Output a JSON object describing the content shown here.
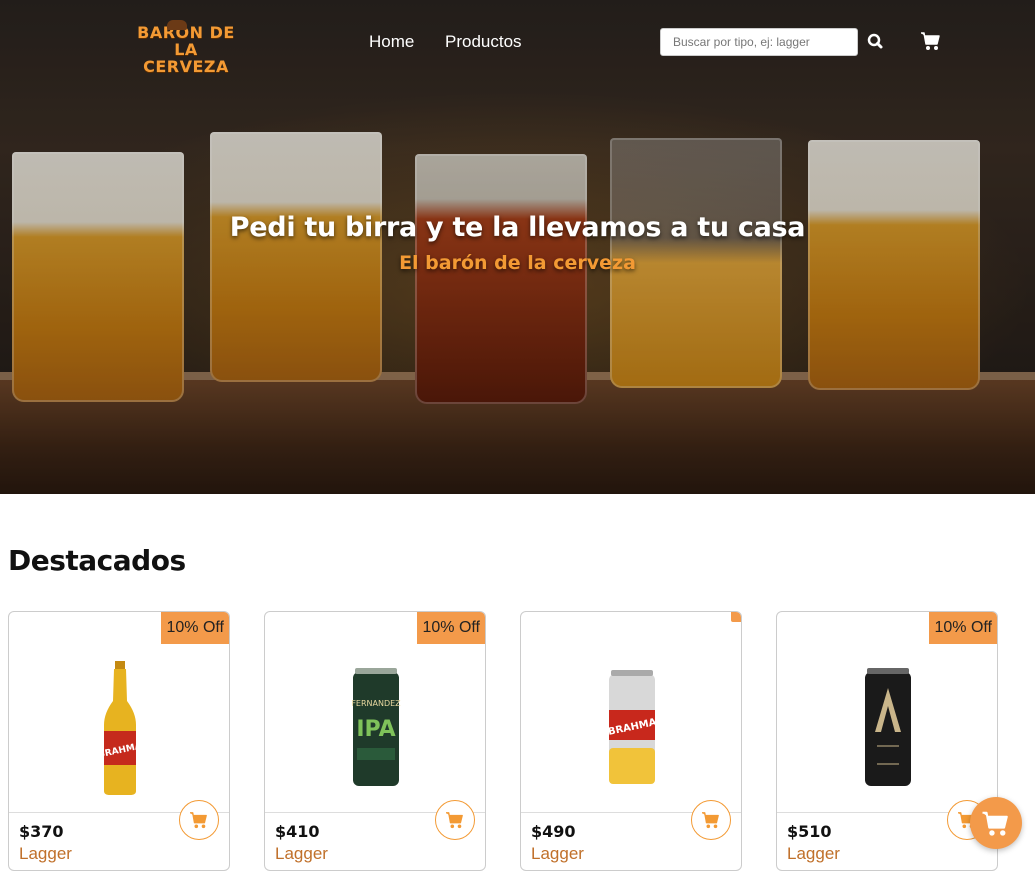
{
  "brand": {
    "line1": "BARÓN DE LA",
    "line2": "CERVEZA"
  },
  "nav": {
    "home": "Home",
    "products": "Productos"
  },
  "search": {
    "placeholder": "Buscar por tipo, ej: lagger",
    "value": ""
  },
  "hero": {
    "title": "Pedi tu birra y te la llevamos a tu casa",
    "subtitle": "El barón de la cerveza"
  },
  "featured": {
    "title": "Destacados",
    "products": [
      {
        "badge": "10% Off",
        "price": "$370",
        "type": "Lagger",
        "image": "brahma-bottle"
      },
      {
        "badge": "10% Off",
        "price": "$410",
        "type": "Lagger",
        "image": "patagonia-ipa-can"
      },
      {
        "badge": "",
        "price": "$490",
        "type": "Lagger",
        "image": "brahma-chopp-can"
      },
      {
        "badge": "10% Off",
        "price": "$510",
        "type": "Lagger",
        "image": "andes-negra-can"
      }
    ]
  },
  "colors": {
    "accent": "#f39a34",
    "badge": "#f39a4a",
    "type_text": "#c0702a"
  },
  "icons": {
    "search": "search-icon",
    "cart": "shopping-cart-icon",
    "add": "add-to-cart-icon"
  }
}
